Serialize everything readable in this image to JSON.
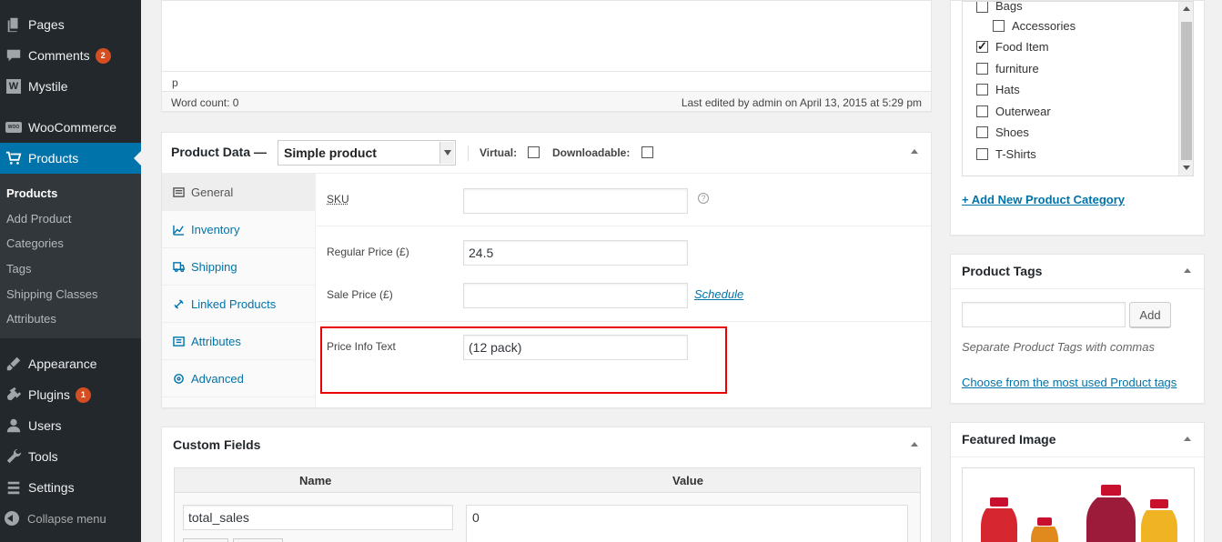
{
  "sidebar": {
    "items": [
      {
        "label": "Pages",
        "icon": "pages-icon"
      },
      {
        "label": "Comments",
        "icon": "comments-icon",
        "badge": "2"
      },
      {
        "label": "Mystile",
        "icon": "mystile-icon"
      },
      {
        "label": "WooCommerce",
        "icon": "woocommerce-icon"
      },
      {
        "label": "Products",
        "icon": "cart-icon"
      },
      {
        "label": "Appearance",
        "icon": "brush-icon"
      },
      {
        "label": "Plugins",
        "icon": "plug-icon",
        "badge": "1"
      },
      {
        "label": "Users",
        "icon": "user-icon"
      },
      {
        "label": "Tools",
        "icon": "wrench-icon"
      },
      {
        "label": "Settings",
        "icon": "settings-icon"
      }
    ],
    "mystile_glyph": "W",
    "woo_glyph": "WOO",
    "submenu": [
      "Products",
      "Add Product",
      "Categories",
      "Tags",
      "Shipping Classes",
      "Attributes"
    ],
    "collapse_label": "Collapse menu"
  },
  "editor": {
    "path": "p",
    "word_count": "Word count: 0",
    "last_edited": "Last edited by admin on April 13, 2015 at 5:29 pm"
  },
  "product_data": {
    "title": "Product Data —",
    "type_selected": "Simple product",
    "virtual_label": "Virtual:",
    "downloadable_label": "Downloadable:",
    "tabs": [
      {
        "label": "General",
        "icon": "general-icon"
      },
      {
        "label": "Inventory",
        "icon": "inventory-icon"
      },
      {
        "label": "Shipping",
        "icon": "shipping-icon"
      },
      {
        "label": "Linked Products",
        "icon": "link-icon"
      },
      {
        "label": "Attributes",
        "icon": "attributes-icon"
      },
      {
        "label": "Advanced",
        "icon": "gear-icon"
      }
    ],
    "sku_label": "SKU",
    "sku_value": "",
    "help_glyph": "?",
    "regular_price_label": "Regular Price (£)",
    "regular_price_value": "24.5",
    "sale_price_label": "Sale Price (£)",
    "sale_price_value": "",
    "schedule_link": "Schedule",
    "price_info_label": "Price Info Text",
    "price_info_value": "(12 pack)"
  },
  "custom_fields": {
    "title": "Custom Fields",
    "col_name": "Name",
    "col_value": "Value",
    "row_name": "total_sales",
    "row_value": "0"
  },
  "categories": {
    "items": [
      {
        "label": "Bags",
        "checked": false,
        "indent": 0
      },
      {
        "label": "Accessories",
        "checked": false,
        "indent": 1
      },
      {
        "label": "Food Item",
        "checked": true,
        "indent": 0
      },
      {
        "label": "furniture",
        "checked": false,
        "indent": 0
      },
      {
        "label": "Hats",
        "checked": false,
        "indent": 0
      },
      {
        "label": "Outerwear",
        "checked": false,
        "indent": 0
      },
      {
        "label": "Shoes",
        "checked": false,
        "indent": 0
      },
      {
        "label": "T-Shirts",
        "checked": false,
        "indent": 0
      }
    ],
    "add_link": "+ Add New Product Category"
  },
  "tags": {
    "title": "Product Tags",
    "input_value": "",
    "add_button": "Add",
    "hint": "Separate Product Tags with commas",
    "choose_link": "Choose from the most used Product tags"
  },
  "featured": {
    "title": "Featured Image"
  },
  "colors": {
    "sidebar_bg": "#23282d",
    "accent": "#0073aa",
    "badge": "#d54e21",
    "highlight": "#e00000"
  }
}
